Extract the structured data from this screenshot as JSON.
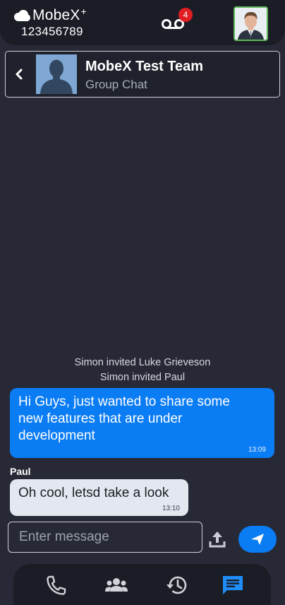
{
  "header": {
    "brand_name": "MobeX",
    "brand_plus": "+",
    "user_number": "123456789",
    "voicemail_count": "4"
  },
  "chat": {
    "title": "MobeX Test Team",
    "subtitle": "Group Chat"
  },
  "system_messages": [
    "Simon invited Luke Grieveson",
    "Simon invited Paul"
  ],
  "messages": [
    {
      "direction": "outgoing",
      "text": "Hi Guys,  just wanted to share some new features that are under development",
      "time": "13:09"
    },
    {
      "direction": "incoming",
      "sender": "Paul",
      "text": "Oh cool, letsd take a look",
      "time": "13:10"
    }
  ],
  "composer": {
    "placeholder": "Enter message",
    "value": ""
  },
  "nav": {
    "items": [
      {
        "name": "calls",
        "icon": "phone-icon",
        "active": false
      },
      {
        "name": "contacts",
        "icon": "group-icon",
        "active": false
      },
      {
        "name": "history",
        "icon": "history-icon",
        "active": false
      },
      {
        "name": "chat",
        "icon": "chat-icon",
        "active": true
      }
    ]
  },
  "colors": {
    "background": "#272a36",
    "bar": "#1b1d26",
    "accent": "#0a7cf4",
    "badge": "#e01e22",
    "incoming_bubble": "#e3e7f0"
  }
}
